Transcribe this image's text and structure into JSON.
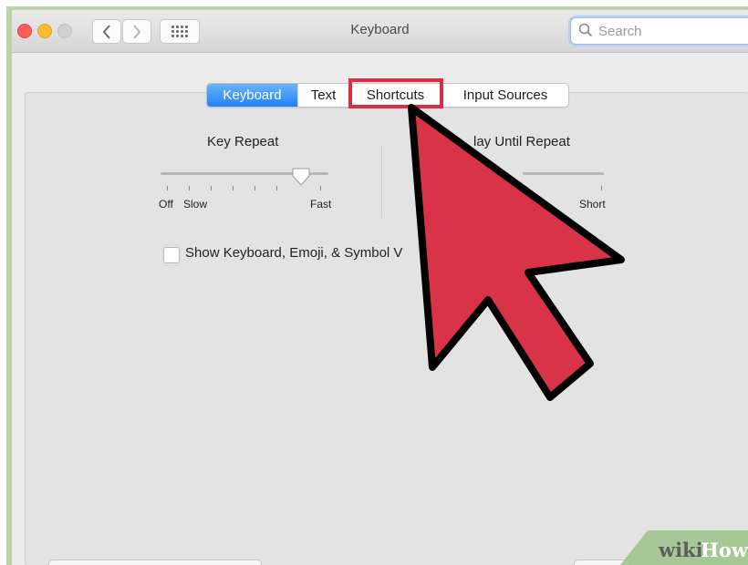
{
  "window": {
    "title": "Keyboard"
  },
  "search": {
    "placeholder": "Search"
  },
  "tabs": [
    {
      "label": "Keyboard",
      "selected": true
    },
    {
      "label": "Text",
      "selected": false
    },
    {
      "label": "Shortcuts",
      "selected": false,
      "highlighted": true
    },
    {
      "label": "Input Sources",
      "selected": false
    }
  ],
  "key_repeat": {
    "title": "Key Repeat",
    "min_label": "Off",
    "slow_label": "Slow",
    "max_label": "Fast",
    "value_fraction": 0.85
  },
  "delay_until_repeat": {
    "title_visible": "lay Until Repeat",
    "max_label": "Short"
  },
  "checkbox": {
    "label_visible": "Show Keyboard, Emoji, & Symbol V",
    "checked": false
  },
  "watermark": {
    "wiki": "wiki",
    "how": "How"
  },
  "colors": {
    "accent": "#1f82f4",
    "highlight": "#d92e43",
    "arrow_fill": "#d93347",
    "frame": "#b8d4a8"
  },
  "icons": [
    "close-light",
    "minimize-light",
    "zoom-light",
    "back-chevron-icon",
    "forward-chevron-icon",
    "show-all-grid-icon",
    "search-icon",
    "pointer-arrow-icon"
  ]
}
